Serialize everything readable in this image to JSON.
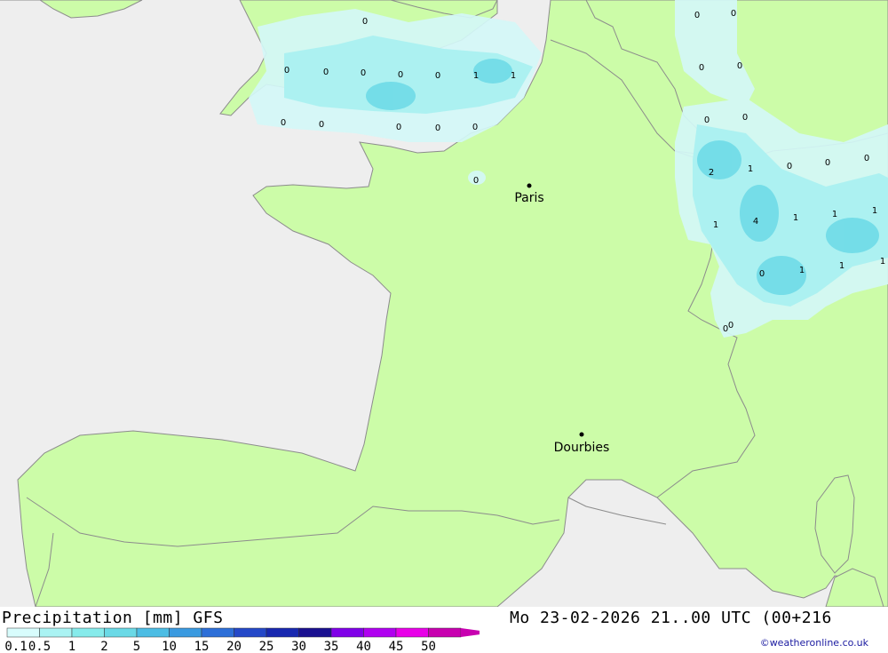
{
  "title": "Precipitation [mm] GFS",
  "datetime": "Mo 23-02-2026 21..00 UTC (00+216",
  "credit": "©weatheronline.co.uk",
  "cities": [
    {
      "name": "Paris"
    },
    {
      "name": "Dourbies"
    }
  ],
  "legend": [
    {
      "label": "0.1",
      "color": "#d8fcfc"
    },
    {
      "label": "0.5",
      "color": "#aaf3f3"
    },
    {
      "label": "1",
      "color": "#86ebeb"
    },
    {
      "label": "2",
      "color": "#6ad9e6"
    },
    {
      "label": "5",
      "color": "#4cbde4"
    },
    {
      "label": "10",
      "color": "#3a9ae0"
    },
    {
      "label": "15",
      "color": "#2d6fd8"
    },
    {
      "label": "20",
      "color": "#2448c8"
    },
    {
      "label": "25",
      "color": "#1828b0"
    },
    {
      "label": "30",
      "color": "#1a1090"
    },
    {
      "label": "35",
      "color": "#8000e8"
    },
    {
      "label": "40",
      "color": "#b000f0"
    },
    {
      "label": "45",
      "color": "#e800e8"
    },
    {
      "label": "50",
      "color": "#c800b0"
    }
  ],
  "value_labels": [
    "0",
    "0",
    "0",
    "0",
    "0",
    "0",
    "0",
    "0",
    "0",
    "1",
    "1",
    "0",
    "0",
    "0",
    "0",
    "0",
    "0",
    "0",
    "0",
    "0",
    "0",
    "2",
    "1",
    "0",
    "0",
    "1",
    "1",
    "4",
    "1",
    "1",
    "1",
    "0",
    "1",
    "1",
    "0",
    "0"
  ],
  "colors": {
    "land": "#ccfca8",
    "sea": "#eeeeee",
    "border": "#8c8c8c",
    "light_precip": "#d4f8f8",
    "mid_precip": "#aaf0f0",
    "heavy_precip": "#72dce8"
  }
}
